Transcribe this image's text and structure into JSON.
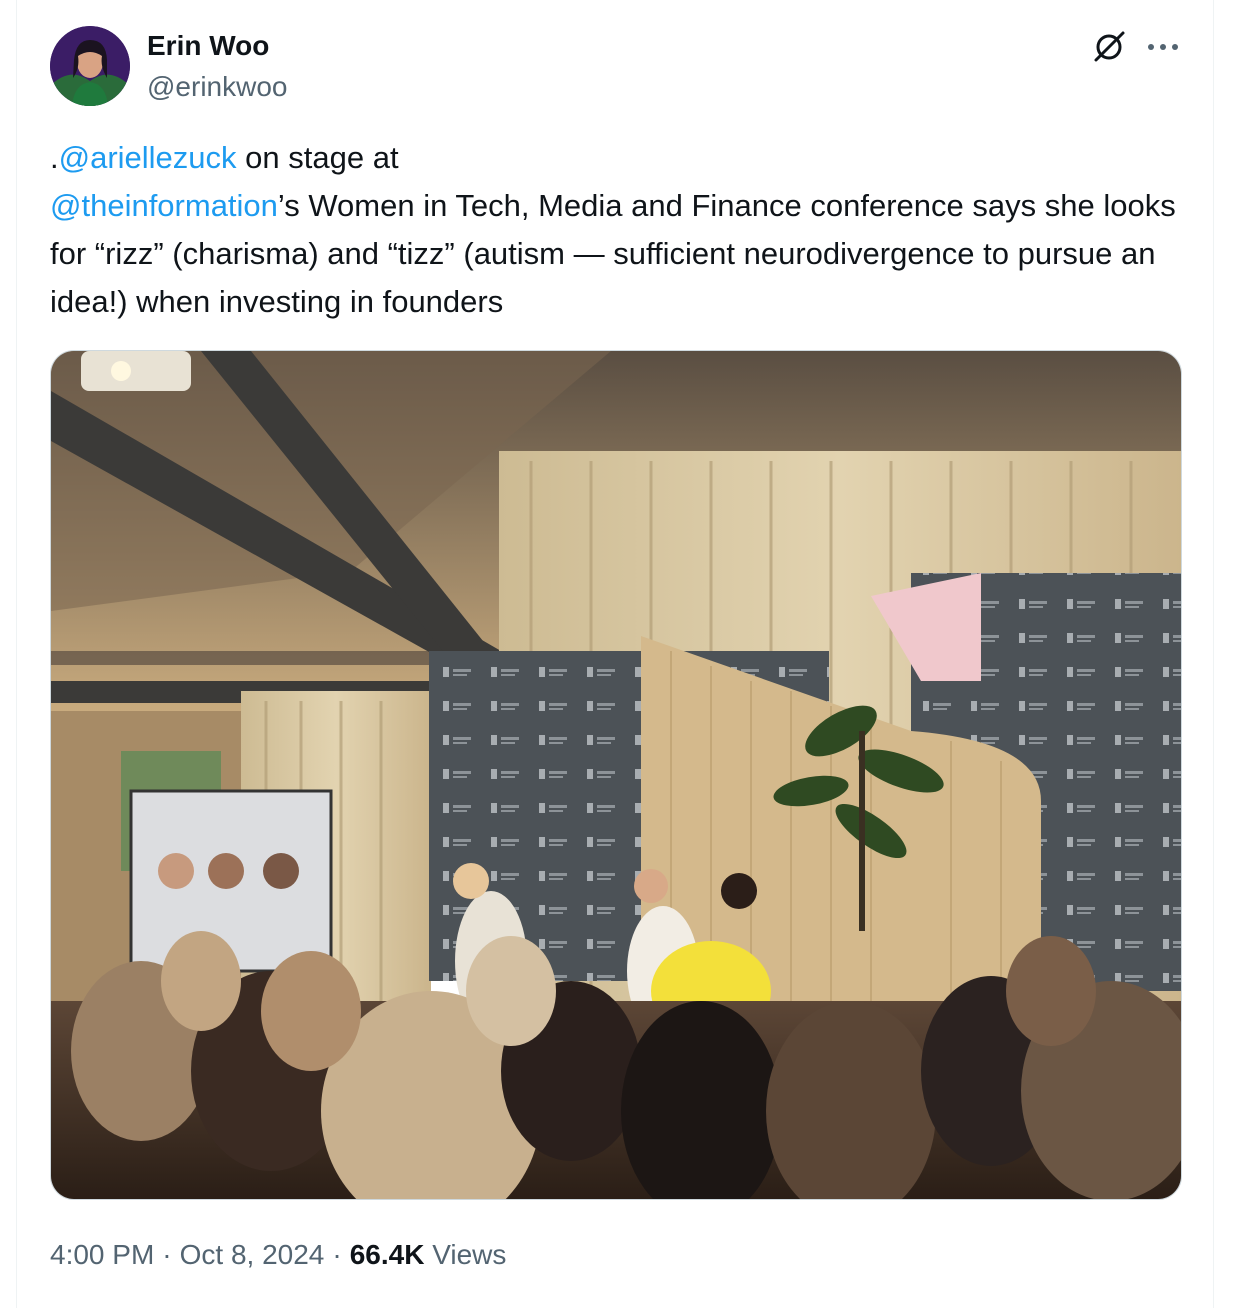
{
  "author": {
    "name": "Erin Woo",
    "handle": "@erinkwoo"
  },
  "tweet": {
    "prefix": ".",
    "mention1": "@ariellezuck",
    "text1": " on stage at ",
    "mention2": "@theinformation",
    "text2": "’s Women in Tech, Media and Finance conference says she looks for “rizz” (charisma) and “tizz” (autism — sufficient neurodivergence to pursue an idea!) when investing in founders"
  },
  "meta": {
    "time": "4:00 PM",
    "separator": "·",
    "date": "Oct 8, 2024",
    "views_count": "66.4K",
    "views_label": "Views"
  },
  "icons": {
    "grok": "grok-icon",
    "more": "more-icon"
  },
  "colors": {
    "link": "#1d9bf0",
    "secondary_text": "#536471",
    "primary_text": "#0f1419"
  }
}
